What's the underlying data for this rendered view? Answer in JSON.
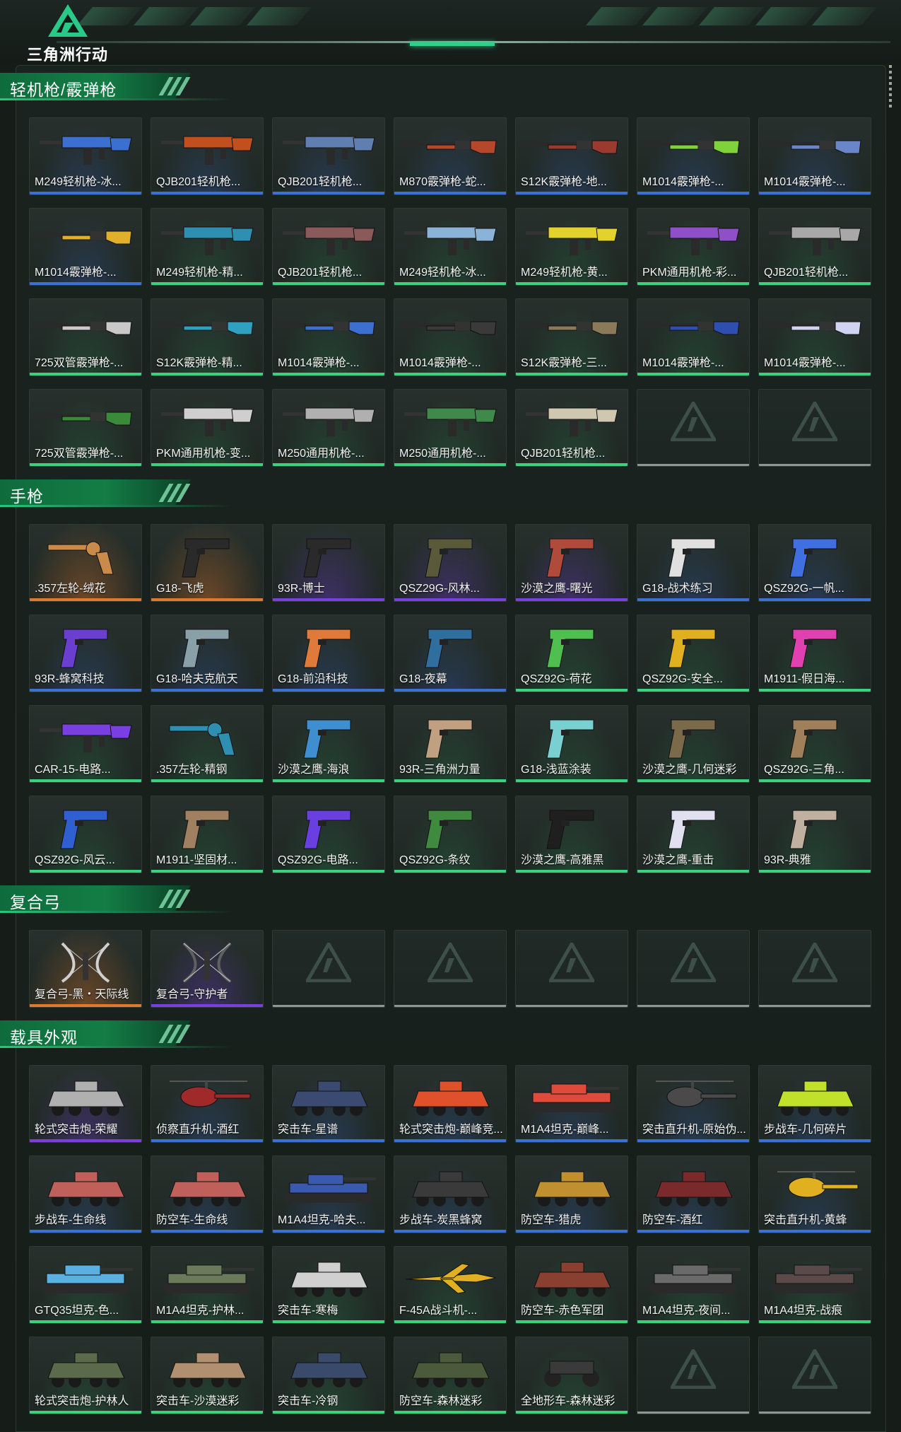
{
  "header": {
    "logo_text": "三角洲行动",
    "logo_icon": "delta-triangle-logo-icon"
  },
  "colors": {
    "accent": "#26c77b",
    "rarity_green": "#3ad27d",
    "rarity_blue": "#3d6fd9",
    "rarity_purple": "#7b3fe0",
    "rarity_orange": "#e0782f",
    "rarity_empty": "#8d9692"
  },
  "sections": [
    {
      "title": "轻机枪/霰弹枪",
      "items": [
        {
          "name": "M249轻机枪-冰...",
          "rarity": "blue",
          "icon": "lmg-icon",
          "tint": "#3b6fd0"
        },
        {
          "name": "QJB201轻机枪...",
          "rarity": "blue",
          "icon": "lmg-icon",
          "tint": "#c2501e"
        },
        {
          "name": "QJB201轻机枪...",
          "rarity": "blue",
          "icon": "lmg-icon",
          "tint": "#5e7fb0"
        },
        {
          "name": "M870霰弹枪-蛇...",
          "rarity": "blue",
          "icon": "shotgun-icon",
          "tint": "#b5482a"
        },
        {
          "name": "S12K霰弹枪-地...",
          "rarity": "blue",
          "icon": "shotgun-icon",
          "tint": "#9b3a2e"
        },
        {
          "name": "M1014霰弹枪-...",
          "rarity": "blue",
          "icon": "shotgun-icon",
          "tint": "#7fd23a"
        },
        {
          "name": "M1014霰弹枪-...",
          "rarity": "blue",
          "icon": "shotgun-icon",
          "tint": "#6a86c9"
        },
        {
          "name": "M1014霰弹枪-...",
          "rarity": "blue",
          "icon": "shotgun-icon",
          "tint": "#e0b02a"
        },
        {
          "name": "M249轻机枪-精...",
          "rarity": "green",
          "icon": "lmg-icon",
          "tint": "#2f8fb0"
        },
        {
          "name": "QJB201轻机枪...",
          "rarity": "green",
          "icon": "lmg-icon",
          "tint": "#8a5a5a"
        },
        {
          "name": "M249轻机枪-冰...",
          "rarity": "green",
          "icon": "lmg-icon",
          "tint": "#8ab3d8"
        },
        {
          "name": "M249轻机枪-黄...",
          "rarity": "green",
          "icon": "lmg-icon",
          "tint": "#e3d22c"
        },
        {
          "name": "PKM通用机枪-彩...",
          "rarity": "green",
          "icon": "lmg-icon",
          "tint": "#8e4fc9"
        },
        {
          "name": "QJB201轻机枪...",
          "rarity": "green",
          "icon": "lmg-icon",
          "tint": "#a8a8a8"
        },
        {
          "name": "725双管霰弹枪-...",
          "rarity": "green",
          "icon": "shotgun-icon",
          "tint": "#c9c9c9"
        },
        {
          "name": "S12K霰弹枪-精...",
          "rarity": "green",
          "icon": "shotgun-icon",
          "tint": "#2fa0c0"
        },
        {
          "name": "M1014霰弹枪-...",
          "rarity": "green",
          "icon": "shotgun-icon",
          "tint": "#3c6fd0"
        },
        {
          "name": "M1014霰弹枪-...",
          "rarity": "green",
          "icon": "shotgun-icon",
          "tint": "#3a3a3a"
        },
        {
          "name": "S12K霰弹枪-三...",
          "rarity": "green",
          "icon": "shotgun-icon",
          "tint": "#8a7a5a"
        },
        {
          "name": "M1014霰弹枪-...",
          "rarity": "green",
          "icon": "shotgun-icon",
          "tint": "#2f4fb0"
        },
        {
          "name": "M1014霰弹枪-...",
          "rarity": "green",
          "icon": "shotgun-icon",
          "tint": "#d0d4f0"
        },
        {
          "name": "725双管霰弹枪-...",
          "rarity": "green",
          "icon": "shotgun-icon",
          "tint": "#3a8a3a"
        },
        {
          "name": "PKM通用机枪-变...",
          "rarity": "green",
          "icon": "lmg-icon",
          "tint": "#cfcfcf"
        },
        {
          "name": "M250通用机枪-...",
          "rarity": "green",
          "icon": "lmg-icon",
          "tint": "#b0b0b0"
        },
        {
          "name": "M250通用机枪-...",
          "rarity": "green",
          "icon": "lmg-icon",
          "tint": "#3f8a4a"
        },
        {
          "name": "QJB201轻机枪...",
          "rarity": "green",
          "icon": "lmg-icon",
          "tint": "#cfc7b0"
        },
        {
          "name": "",
          "rarity": "empty"
        },
        {
          "name": "",
          "rarity": "empty"
        }
      ]
    },
    {
      "title": "手枪",
      "items": [
        {
          "name": ".357左轮-绒花",
          "rarity": "orange",
          "icon": "revolver-icon",
          "tint": "#c98a4a"
        },
        {
          "name": "G18-飞虎",
          "rarity": "orange",
          "icon": "pistol-icon",
          "tint": "#2a2a2a"
        },
        {
          "name": "93R-博士",
          "rarity": "purple",
          "icon": "pistol-icon",
          "tint": "#2a2a2a"
        },
        {
          "name": "QSZ29G-风林...",
          "rarity": "purple",
          "icon": "pistol-icon",
          "tint": "#5a5a3a"
        },
        {
          "name": "沙漠之鹰-曙光",
          "rarity": "purple",
          "icon": "pistol-icon",
          "tint": "#b04a3a"
        },
        {
          "name": "G18-战术练习",
          "rarity": "blue",
          "icon": "pistol-icon",
          "tint": "#e0e0e0"
        },
        {
          "name": "QSZ92G-一帆...",
          "rarity": "blue",
          "icon": "pistol-icon",
          "tint": "#3f6fe0"
        },
        {
          "name": "93R-蜂窝科技",
          "rarity": "blue",
          "icon": "pistol-icon",
          "tint": "#6a3fd0"
        },
        {
          "name": "G18-哈夫克航天",
          "rarity": "blue",
          "icon": "pistol-icon",
          "tint": "#8aa0a8"
        },
        {
          "name": "G18-前沿科技",
          "rarity": "blue",
          "icon": "pistol-icon",
          "tint": "#e07a3a"
        },
        {
          "name": "G18-夜幕",
          "rarity": "blue",
          "icon": "pistol-icon",
          "tint": "#2f6fa0"
        },
        {
          "name": "QSZ92G-荷花",
          "rarity": "green",
          "icon": "pistol-icon",
          "tint": "#4fc04f"
        },
        {
          "name": "QSZ92G-安全...",
          "rarity": "green",
          "icon": "pistol-icon",
          "tint": "#e0b020"
        },
        {
          "name": "M1911-假日海...",
          "rarity": "green",
          "icon": "pistol-icon",
          "tint": "#e040b0"
        },
        {
          "name": "CAR-15-电路...",
          "rarity": "green",
          "icon": "rifle-icon",
          "tint": "#7a3fe0"
        },
        {
          "name": ".357左轮-精钢",
          "rarity": "green",
          "icon": "revolver-icon",
          "tint": "#2f8fb0"
        },
        {
          "name": "沙漠之鹰-海浪",
          "rarity": "green",
          "icon": "pistol-icon",
          "tint": "#3f8fd0"
        },
        {
          "name": "93R-三角洲力量",
          "rarity": "green",
          "icon": "pistol-icon",
          "tint": "#c0a080"
        },
        {
          "name": "G18-浅蓝涂装",
          "rarity": "green",
          "icon": "pistol-icon",
          "tint": "#7ad0d0"
        },
        {
          "name": "沙漠之鹰-几何迷彩",
          "rarity": "green",
          "icon": "pistol-icon",
          "tint": "#7a6a4a"
        },
        {
          "name": "QSZ92G-三角...",
          "rarity": "green",
          "icon": "pistol-icon",
          "tint": "#a0805a"
        },
        {
          "name": "QSZ92G-风云...",
          "rarity": "green",
          "icon": "pistol-icon",
          "tint": "#2f5fd0"
        },
        {
          "name": "M1911-坚固材...",
          "rarity": "green",
          "icon": "pistol-icon",
          "tint": "#a08060"
        },
        {
          "name": "QSZ92G-电路...",
          "rarity": "green",
          "icon": "pistol-icon",
          "tint": "#6a3fe0"
        },
        {
          "name": "QSZ92G-条纹",
          "rarity": "green",
          "icon": "pistol-icon",
          "tint": "#3f8a3f"
        },
        {
          "name": "沙漠之鹰-高雅黑",
          "rarity": "green",
          "icon": "pistol-icon",
          "tint": "#1f1f1f"
        },
        {
          "name": "沙漠之鹰-重击",
          "rarity": "green",
          "icon": "pistol-icon",
          "tint": "#e0e0f0"
        },
        {
          "name": "93R-典雅",
          "rarity": "green",
          "icon": "pistol-icon",
          "tint": "#c0b0a0"
        }
      ]
    },
    {
      "title": "复合弓",
      "items": [
        {
          "name": "复合弓-黑・天际线",
          "rarity": "orange",
          "icon": "compound-bow-icon",
          "tint": "#d0d0d0"
        },
        {
          "name": "复合弓-守护者",
          "rarity": "purple",
          "icon": "compound-bow-icon",
          "tint": "#606060"
        },
        {
          "name": "",
          "rarity": "empty"
        },
        {
          "name": "",
          "rarity": "empty"
        },
        {
          "name": "",
          "rarity": "empty"
        },
        {
          "name": "",
          "rarity": "empty"
        },
        {
          "name": "",
          "rarity": "empty"
        }
      ]
    },
    {
      "title": "载具外观",
      "items": [
        {
          "name": "轮式突击炮-荣耀",
          "rarity": "purple",
          "icon": "vehicle-icon",
          "tint": "#b0b0b0"
        },
        {
          "name": "侦察直升机-酒红",
          "rarity": "blue",
          "icon": "helicopter-icon",
          "tint": "#a02a2a"
        },
        {
          "name": "突击车-星谱",
          "rarity": "blue",
          "icon": "vehicle-icon",
          "tint": "#3a4a70"
        },
        {
          "name": "轮式突击炮-巅峰竞...",
          "rarity": "blue",
          "icon": "vehicle-icon",
          "tint": "#e0502a"
        },
        {
          "name": "M1A4坦克-巅峰...",
          "rarity": "blue",
          "icon": "tank-icon",
          "tint": "#e04a3a"
        },
        {
          "name": "突击直升机-原始伪...",
          "rarity": "blue",
          "icon": "helicopter-icon",
          "tint": "#4a4a4a"
        },
        {
          "name": "步战车-几何碎片",
          "rarity": "blue",
          "icon": "vehicle-icon",
          "tint": "#c0e02a"
        },
        {
          "name": "步战车-生命线",
          "rarity": "blue",
          "icon": "vehicle-icon",
          "tint": "#c0605a"
        },
        {
          "name": "防空车-生命线",
          "rarity": "blue",
          "icon": "vehicle-icon",
          "tint": "#c0605a"
        },
        {
          "name": "M1A4坦克-哈夫...",
          "rarity": "blue",
          "icon": "tank-icon",
          "tint": "#3a5ab0"
        },
        {
          "name": "步战车-炭黑蜂窝",
          "rarity": "blue",
          "icon": "vehicle-icon",
          "tint": "#3a3a3a"
        },
        {
          "name": "防空车-猎虎",
          "rarity": "blue",
          "icon": "vehicle-icon",
          "tint": "#c09030"
        },
        {
          "name": "防空车-酒红",
          "rarity": "blue",
          "icon": "vehicle-icon",
          "tint": "#7a2a2a"
        },
        {
          "name": "突击直升机-黄蜂",
          "rarity": "blue",
          "icon": "helicopter-icon",
          "tint": "#e0b020"
        },
        {
          "name": "GTQ35坦克-色...",
          "rarity": "green",
          "icon": "tank-icon",
          "tint": "#5ab0e0"
        },
        {
          "name": "M1A4坦克-护林...",
          "rarity": "green",
          "icon": "tank-icon",
          "tint": "#6a7a5a"
        },
        {
          "name": "突击车-寒梅",
          "rarity": "green",
          "icon": "vehicle-icon",
          "tint": "#d0d0d0"
        },
        {
          "name": "F-45A战斗机-...",
          "rarity": "green",
          "icon": "jet-icon",
          "tint": "#e0b020"
        },
        {
          "name": "防空车-赤色军团",
          "rarity": "green",
          "icon": "vehicle-icon",
          "tint": "#8a4030"
        },
        {
          "name": "M1A4坦克-夜间...",
          "rarity": "green",
          "icon": "tank-icon",
          "tint": "#6a6a6a"
        },
        {
          "name": "M1A4坦克-战痕",
          "rarity": "green",
          "icon": "tank-icon",
          "tint": "#5a4a4a"
        },
        {
          "name": "轮式突击炮-护林人",
          "rarity": "green",
          "icon": "vehicle-icon",
          "tint": "#5a6a4a"
        },
        {
          "name": "突击车-沙漠迷彩",
          "rarity": "green",
          "icon": "vehicle-icon",
          "tint": "#b09070"
        },
        {
          "name": "突击车-冷钢",
          "rarity": "green",
          "icon": "vehicle-icon",
          "tint": "#3a4a6a"
        },
        {
          "name": "防空车-森林迷彩",
          "rarity": "green",
          "icon": "vehicle-icon",
          "tint": "#4a5a3a"
        },
        {
          "name": "全地形车-森林迷彩",
          "rarity": "green",
          "icon": "atv-icon",
          "tint": "#3a3a3a"
        },
        {
          "name": "",
          "rarity": "empty"
        },
        {
          "name": "",
          "rarity": "empty"
        }
      ]
    }
  ]
}
